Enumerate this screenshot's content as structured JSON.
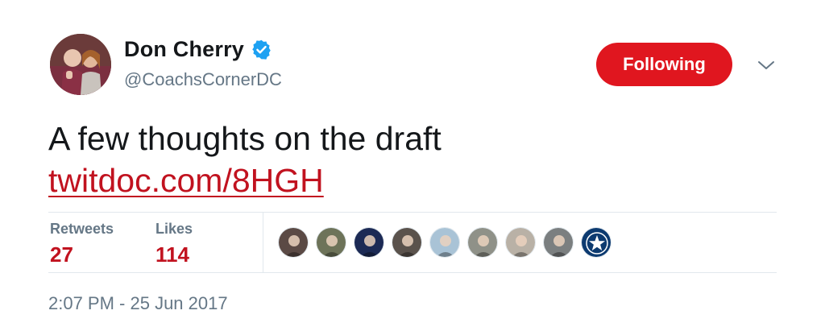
{
  "author": {
    "name": "Don Cherry",
    "handle": "@CoachsCornerDC",
    "verified": true,
    "avatar_icon": "profile-photo"
  },
  "follow_button": {
    "label": "Following",
    "color": "#e0161f"
  },
  "menu": {
    "icon": "chevron-down-icon"
  },
  "tweet": {
    "text": "A few thoughts on the draft",
    "link": "twitdoc.com/8HGH",
    "link_color": "#c1121f"
  },
  "stats": {
    "retweets_label": "Retweets",
    "retweets_value": "27",
    "likes_label": "Likes",
    "likes_value": "114"
  },
  "likers": [
    {
      "icon": "liker-avatar-1",
      "color": "#5b4a45"
    },
    {
      "icon": "liker-avatar-2",
      "color": "#6d7359"
    },
    {
      "icon": "liker-avatar-3",
      "color": "#1c2a55"
    },
    {
      "icon": "liker-avatar-4",
      "color": "#5a524c"
    },
    {
      "icon": "liker-avatar-5",
      "color": "#a9c3d6"
    },
    {
      "icon": "liker-avatar-6",
      "color": "#8f9188"
    },
    {
      "icon": "liker-avatar-7",
      "color": "#b9b1a6"
    },
    {
      "icon": "liker-avatar-8",
      "color": "#7b7f80"
    },
    {
      "icon": "liker-avatar-9",
      "color": "#0c3a70"
    }
  ],
  "timestamp": "2:07 PM - 25 Jun 2017"
}
